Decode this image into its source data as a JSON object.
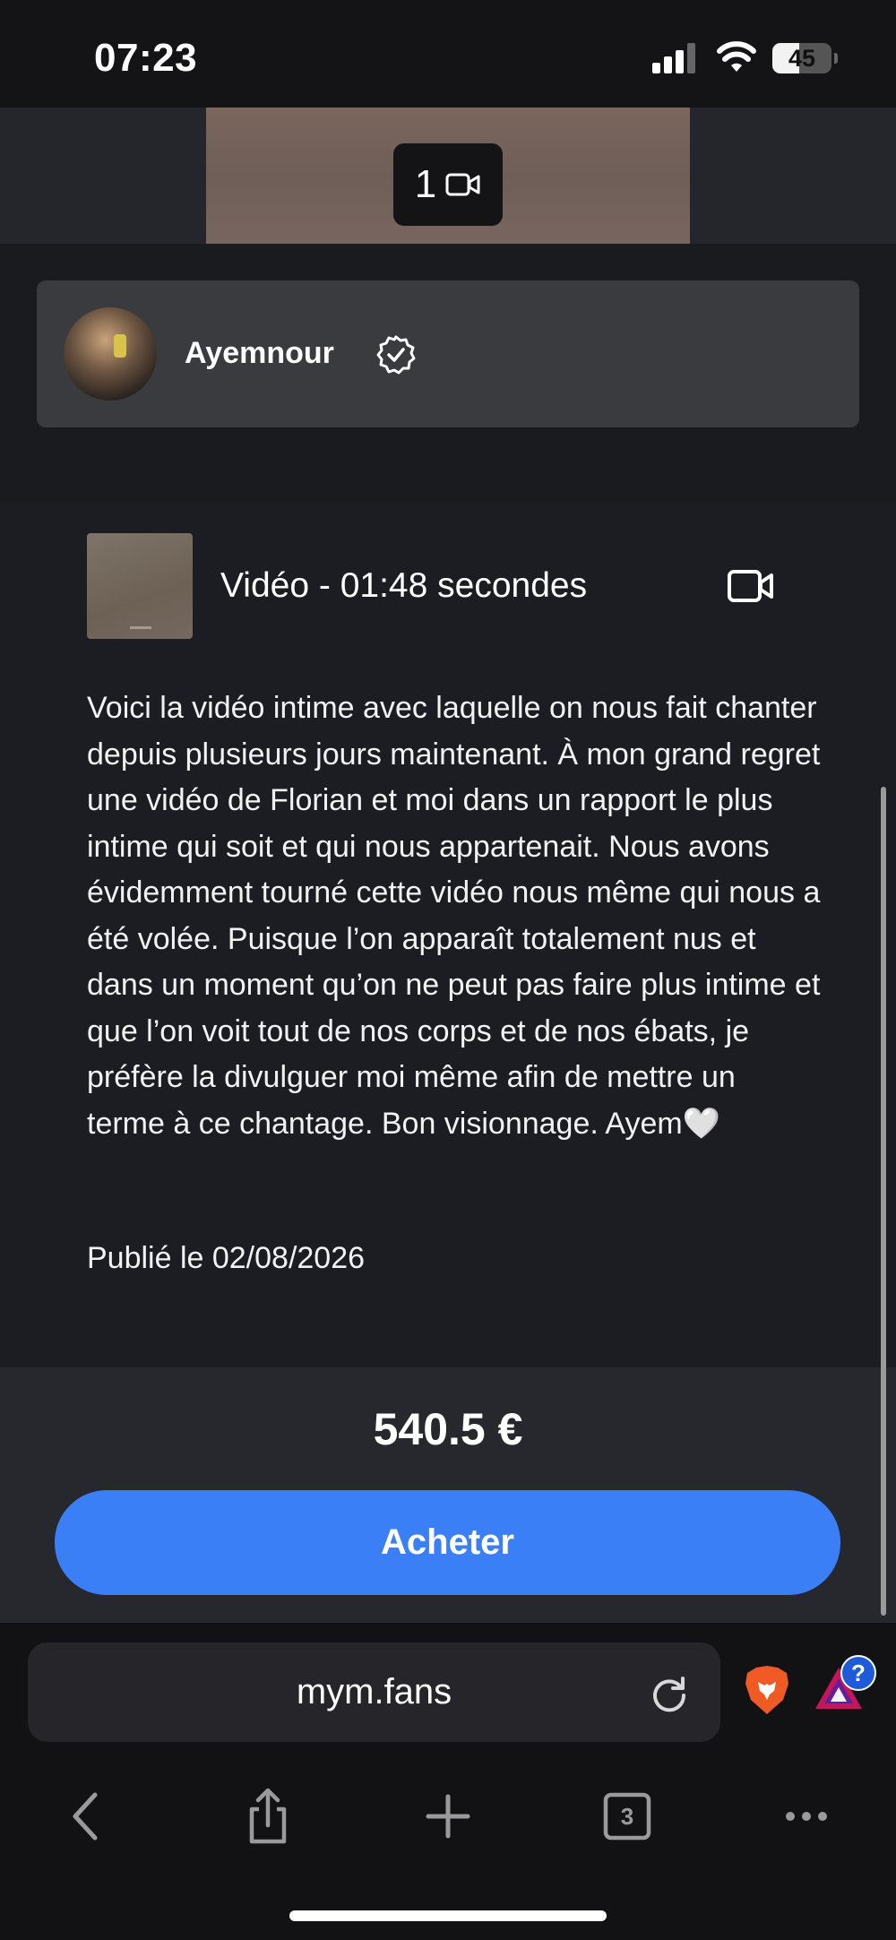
{
  "status_bar": {
    "time": "07:23",
    "battery_level": "45",
    "icons": [
      "signal-icon",
      "wifi-icon",
      "battery-icon"
    ]
  },
  "media_strip": {
    "count": "1",
    "icon": "video-camera-icon"
  },
  "creator": {
    "name": "Ayemnour",
    "verified_icon": "verified-badge-icon"
  },
  "post": {
    "video_label": "Vidéo - 01:48 secondes",
    "video_icon": "video-camera-icon",
    "description": "Voici la vidéo intime avec laquelle on nous fait chanter depuis plusieurs jours maintenant. À mon grand regret une vidéo de Florian et moi dans un rapport le plus intime qui soit et qui nous appartenait. Nous avons évidemment tourné cette vidéo nous même qui nous a été volée. Puisque l’on apparaît totalement nus et dans un moment qu’on ne peut pas faire plus intime et que l’on voit tout de nos corps et de nos ébats, je préfère la divulguer moi même afin de mettre un terme à ce chantage. Bon visionnage. Ayem🤍",
    "published": "Publié le 02/08/2026"
  },
  "purchase": {
    "price": "540.5 €",
    "buy_label": "Acheter",
    "accent_color": "#3a7ff6"
  },
  "browser": {
    "address": "mym.fans",
    "tab_count": "3",
    "help_badge": "?",
    "toolbar_icons": [
      "back-icon",
      "share-icon",
      "new-tab-icon",
      "tabs-icon",
      "more-icon"
    ]
  }
}
